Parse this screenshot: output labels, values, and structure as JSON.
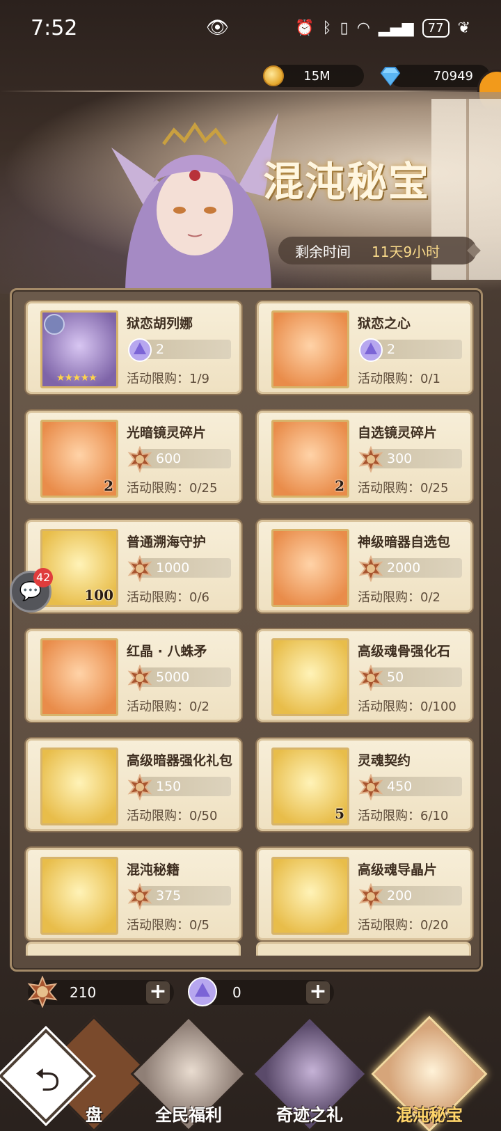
{
  "status_bar": {
    "time": "7:52",
    "battery": "77"
  },
  "currency": {
    "gold": "15M",
    "diamond": "70949"
  },
  "event": {
    "title": "混沌秘宝",
    "timer_label": "剩余时间",
    "timer_value": "11天9小时"
  },
  "items": [
    {
      "name": "狱恋胡列娜",
      "price": "2",
      "currency": "purple-token",
      "limit": "活动限购：1/9",
      "count": "",
      "stars": "★★★★★",
      "theme": "purple"
    },
    {
      "name": "狱恋之心",
      "price": "2",
      "currency": "purple-token",
      "limit": "活动限购：0/1",
      "count": "",
      "theme": "orange"
    },
    {
      "name": "光暗镜灵碎片",
      "price": "600",
      "currency": "bronze-medal",
      "limit": "活动限购：0/25",
      "count": "2",
      "theme": "orange"
    },
    {
      "name": "自选镜灵碎片",
      "price": "300",
      "currency": "bronze-medal",
      "limit": "活动限购：0/25",
      "count": "2",
      "theme": "orange"
    },
    {
      "name": "普通溯海守护",
      "price": "1000",
      "currency": "bronze-medal",
      "limit": "活动限购：0/6",
      "count": "100",
      "theme": "gold"
    },
    {
      "name": "神级暗器自选包",
      "price": "2000",
      "currency": "bronze-medal",
      "limit": "活动限购：0/2",
      "count": "",
      "theme": "orange"
    },
    {
      "name": "红晶 · 八蛛矛",
      "price": "5000",
      "currency": "bronze-medal",
      "limit": "活动限购：0/2",
      "count": "",
      "theme": "orange"
    },
    {
      "name": "高级魂骨强化石",
      "price": "50",
      "currency": "bronze-medal",
      "limit": "活动限购：0/100",
      "count": "",
      "theme": "gold"
    },
    {
      "name": "高级暗器强化礼包",
      "price": "150",
      "currency": "bronze-medal",
      "limit": "活动限购：0/50",
      "count": "",
      "theme": "gold"
    },
    {
      "name": "灵魂契约",
      "price": "450",
      "currency": "bronze-medal",
      "limit": "活动限购：6/10",
      "count": "5",
      "theme": "gold"
    },
    {
      "name": "混沌秘籍",
      "price": "375",
      "currency": "bronze-medal",
      "limit": "活动限购：0/5",
      "count": "",
      "theme": "gold"
    },
    {
      "name": "高级魂导晶片",
      "price": "200",
      "currency": "bronze-medal",
      "limit": "活动限购：0/20",
      "count": "",
      "theme": "gold"
    }
  ],
  "chat": {
    "badge": "42"
  },
  "wallet": {
    "bronze_medal": "210",
    "purple_token": "0",
    "plus": "+"
  },
  "nav": {
    "back_glyph": "⮌",
    "tabs": [
      {
        "label": "盘",
        "active": false
      },
      {
        "label": "全民福利",
        "active": false
      },
      {
        "label": "奇迹之礼",
        "active": false
      },
      {
        "label": "混沌秘宝",
        "active": true
      }
    ]
  },
  "colors": {
    "accent_gold": "#ffd56a",
    "card_bg": "#f7eed8",
    "badge_red": "#e03c3c"
  }
}
